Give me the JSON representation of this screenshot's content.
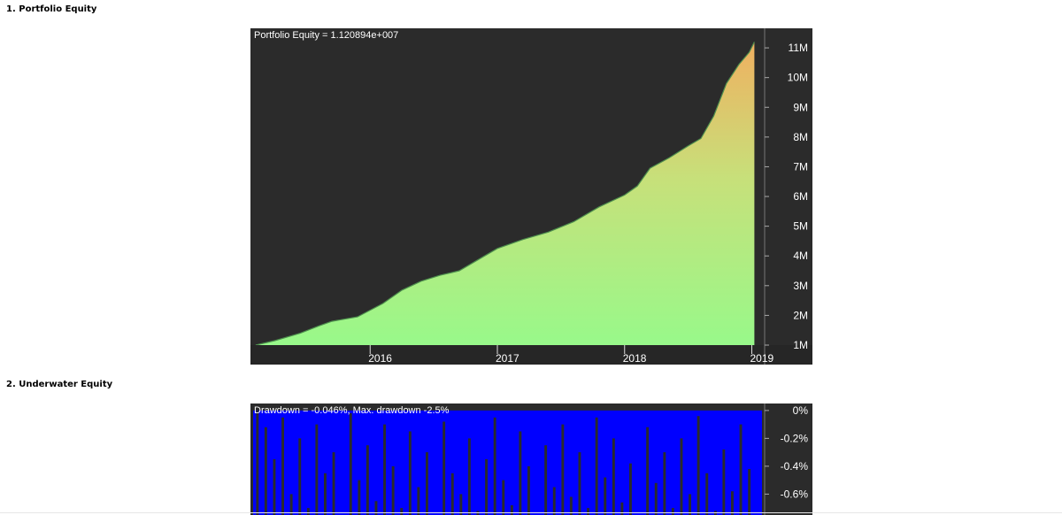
{
  "sections": [
    {
      "title": "1. Portfolio Equity"
    },
    {
      "title": "2. Underwater Equity"
    }
  ],
  "chart_data": [
    {
      "type": "area",
      "title": "Portfolio Equity = 1.120894e+007",
      "y_tick_labels": [
        "1M",
        "2M",
        "3M",
        "4M",
        "5M",
        "6M",
        "7M",
        "8M",
        "9M",
        "10M",
        "11M"
      ],
      "y_tick_values": [
        1000000,
        2000000,
        3000000,
        4000000,
        5000000,
        6000000,
        7000000,
        8000000,
        9000000,
        10000000,
        11000000
      ],
      "x_tick_labels": [
        "2016",
        "2017",
        "2018",
        "2019"
      ],
      "x_tick_values": [
        2016.0,
        2017.0,
        2018.0,
        2019.0
      ],
      "xlim": [
        2015.08,
        2019.08
      ],
      "ylim": [
        1000000,
        11300000
      ],
      "colors": {
        "background": "#2b2b2b",
        "fill_low": "#98f98a",
        "fill_high": "#f0b060",
        "line": "#4e8f4e"
      },
      "series": [
        {
          "x": [
            2015.1,
            2015.25,
            2015.45,
            2015.6,
            2015.7,
            2015.9,
            2016.1,
            2016.25,
            2016.4,
            2016.55,
            2016.7,
            2016.9,
            2017.0,
            2017.2,
            2017.4,
            2017.6,
            2017.8,
            2018.0,
            2018.1,
            2018.2,
            2018.35,
            2018.5,
            2018.6,
            2018.7,
            2018.8,
            2018.9,
            2018.98,
            2019.02
          ],
          "y": [
            1000000,
            1150000,
            1400000,
            1650000,
            1800000,
            1950000,
            2400000,
            2850000,
            3150000,
            3350000,
            3500000,
            4000000,
            4250000,
            4550000,
            4800000,
            5150000,
            5650000,
            6050000,
            6350000,
            6950000,
            7300000,
            7700000,
            7950000,
            8700000,
            9800000,
            10450000,
            10850000,
            11200000
          ]
        }
      ]
    },
    {
      "type": "area",
      "title": "Drawdown = -0.046%, Max. drawdown -2.5%",
      "y_tick_labels": [
        "0%",
        "-0.2%",
        "-0.4%",
        "-0.6%"
      ],
      "y_tick_values": [
        0,
        -0.2,
        -0.4,
        -0.6
      ],
      "ylim": [
        -0.75,
        0.05
      ],
      "colors": {
        "background": "#2b2b2b",
        "fill": "#0000ff"
      },
      "series": [
        {
          "name": "",
          "values_pct": [
            0,
            -0.12,
            -0.35,
            -0.05,
            -0.6,
            -0.2,
            -0.7,
            -0.1,
            -0.45,
            -0.3,
            -0.75,
            -0.02,
            -0.5,
            -0.25,
            -0.65,
            -0.1,
            -0.4,
            -0.7,
            -0.15,
            -0.55,
            -0.3,
            -0.75,
            -0.08,
            -0.45,
            -0.6,
            -0.2,
            -0.72,
            -0.35,
            -0.05,
            -0.5,
            -0.68,
            -0.15,
            -0.4,
            -0.75,
            -0.25,
            -0.55,
            -0.1,
            -0.62,
            -0.3,
            -0.7,
            -0.05,
            -0.48,
            -0.2,
            -0.66,
            -0.38,
            -0.75,
            -0.12,
            -0.52,
            -0.3,
            -0.7,
            -0.2,
            -0.6,
            -0.04,
            -0.45,
            -0.72,
            -0.28,
            -0.58,
            -0.1,
            -0.42,
            -0.75
          ]
        }
      ]
    }
  ]
}
